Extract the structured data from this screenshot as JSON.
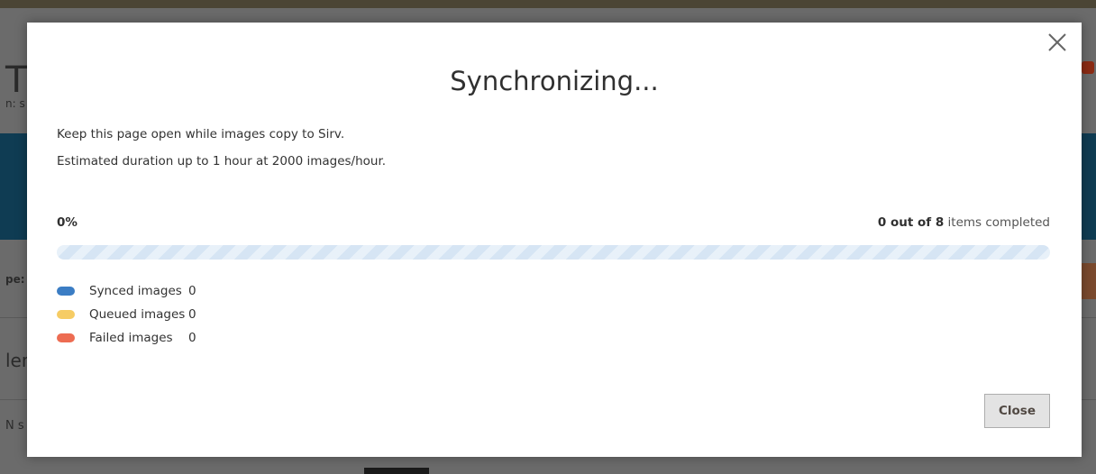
{
  "background": {
    "title_fragment": "T\\",
    "subtitle_fragment": "n: s",
    "type_label_fragment": "pe:",
    "heading_fragment": "len",
    "row_fragment": "N s"
  },
  "modal": {
    "title": "Synchronizing...",
    "description_line1": "Keep this page open while images copy to Sirv.",
    "description_line2": "Estimated duration up to 1 hour at 2000 images/hour.",
    "progress_percent_label": "0%",
    "progress_fraction": 0,
    "completed_count": "0 out of 8",
    "completed_suffix": " items completed",
    "legend": [
      {
        "label": "Synced images",
        "value": "0",
        "color": "#3b7dc4"
      },
      {
        "label": "Queued images",
        "value": "0",
        "color": "#f6cc64"
      },
      {
        "label": "Failed images",
        "value": "0",
        "color": "#ed6c52"
      }
    ],
    "close_button_label": "Close",
    "close_icon": "close-icon"
  }
}
